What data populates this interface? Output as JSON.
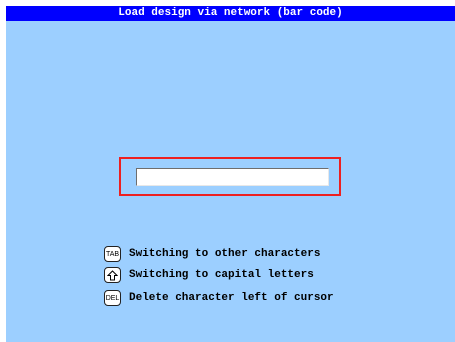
{
  "window": {
    "title": "Load design via network (bar code)"
  },
  "barcode_input": {
    "value": "",
    "placeholder": ""
  },
  "legend": [
    {
      "key_label": "TAB",
      "key_icon": "tab-key-icon",
      "text": "Switching to other characters"
    },
    {
      "key_label": "",
      "key_icon": "shift-arrow-key-icon",
      "text": "Switching to capital letters"
    },
    {
      "key_label": "DEL",
      "key_icon": "del-key-icon",
      "text": "Delete character left of cursor"
    }
  ],
  "colors": {
    "background": "#9ccfff",
    "titlebar": "#0000ff",
    "input_highlight": "#ee2020"
  }
}
